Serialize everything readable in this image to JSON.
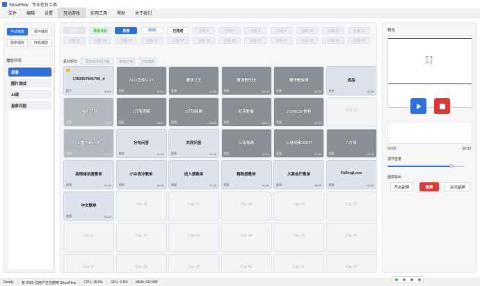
{
  "app": {
    "title": "ShowFlow · 专业控台工具"
  },
  "menu": [
    "文件",
    "编辑",
    "设置",
    "互动游戏",
    "实用工具",
    "帮助",
    "关于我们"
  ],
  "menu_active_index": 3,
  "left": {
    "modes": [
      "手动播放",
      "循环播放",
      "顺序播放",
      "随机播放"
    ],
    "modes_active_index": 0,
    "playlist_label": "播放列表",
    "playlists": [
      "昊香",
      "图片测试",
      "AI课",
      "皇家花园"
    ],
    "playlist_active_index": 0
  },
  "tabs": {
    "row1": [
      {
        "label": "测试",
        "style": "gray"
      },
      {
        "label": "模板体验",
        "style": "green"
      },
      {
        "label": "昊香",
        "style": "blue"
      },
      {
        "label": "2025",
        "style": "bluetxt"
      },
      {
        "label": "已完成",
        "style": "dark"
      },
      {
        "label": "分组 6"
      },
      {
        "label": "分组 7"
      },
      {
        "label": "分组 8"
      },
      {
        "label": "分组 9"
      },
      {
        "label": "分组 10"
      },
      {
        "label": "分组 11"
      },
      {
        "label": "分组 12"
      }
    ],
    "row2": [
      {
        "label": "分组 13"
      },
      {
        "label": "分组 14"
      },
      {
        "label": "分组 15"
      },
      {
        "label": "分组 16"
      },
      {
        "label": "分组 17"
      },
      {
        "label": "分组 18"
      },
      {
        "label": "分组 19"
      },
      {
        "label": "分组 20"
      },
      {
        "label": "分组 21"
      },
      {
        "label": "分组 22"
      },
      {
        "label": "分组 23"
      },
      {
        "label": "分组 24"
      }
    ]
  },
  "tools": {
    "label": "素材矩阵",
    "buttons": [
      "添加载当前页面",
      "移动分类",
      "分轨播放"
    ]
  },
  "cells": [
    {
      "title": "1783957846790_d",
      "kind": "filled",
      "type": "图片",
      "dur": "00:05",
      "badge": true
    },
    {
      "title": "2026宣传片V2",
      "kind": "thumb",
      "type": "视频",
      "dur": "01:04"
    },
    {
      "title": "暖场文艺",
      "kind": "thumb",
      "type": "视频",
      "dur": "01:39"
    },
    {
      "title": "暖场歌欢快",
      "kind": "thumb",
      "type": "视频",
      "dur": "02:16"
    },
    {
      "title": "暖场歌旋律",
      "kind": "thumb",
      "type": "视频",
      "dur": "02:23"
    },
    {
      "title": "成品",
      "kind": "filled",
      "type": "视频",
      "dur": "00:38"
    },
    {
      "title": "1唱礼开场",
      "kind": "thumb",
      "type": "视频",
      "dur": "01:46"
    },
    {
      "title": "2开场视频",
      "kind": "thumb",
      "type": "视频",
      "dur": "06:23"
    },
    {
      "title": "3开场视频",
      "kind": "thumb",
      "type": "视频",
      "dur": "03:03"
    },
    {
      "title": "纪实影像",
      "kind": "thumb",
      "type": "视频",
      "dur": "00:31"
    },
    {
      "title": "20240130快剪",
      "kind": "thumb",
      "type": "视频",
      "dur": "07:44"
    },
    {
      "title": "Clip 12",
      "kind": "empty"
    },
    {
      "title": "5.重大奇入场",
      "kind": "thumb",
      "type": "视频",
      "dur": "01:44"
    },
    {
      "title": "分句问答",
      "kind": "filled",
      "type": "视频",
      "dur": "01:12"
    },
    {
      "title": "共同问答",
      "kind": "filled",
      "type": "视频",
      "dur": "01:35"
    },
    {
      "title": "父母视频",
      "kind": "thumb",
      "type": "视频",
      "dur": "01:49"
    },
    {
      "title": "父母视频1080P",
      "kind": "thumb",
      "type": "视频",
      "dur": "02:48"
    },
    {
      "title": "7.片尾",
      "kind": "thumb",
      "type": "视频",
      "dur": "02:19"
    },
    {
      "title": "高情绪浓度歌单",
      "kind": "filled",
      "type": "视频",
      "dur": "01:49"
    },
    {
      "title": "小众清冷歌单",
      "kind": "filled",
      "type": "视频",
      "dur": "00:23"
    },
    {
      "title": "送人感歌单",
      "kind": "filled",
      "type": "视频",
      "dur": "01:33"
    },
    {
      "title": "精致感歌单",
      "kind": "filled",
      "type": "视频",
      "dur": "01:45"
    },
    {
      "title": "大宴会厅歌单",
      "kind": "filled",
      "type": "视频",
      "dur": "02:09"
    },
    {
      "title": "FallingLove",
      "kind": "filled",
      "type": "视频",
      "dur": "02:04"
    },
    {
      "title": "中文歌单",
      "kind": "filled",
      "type": "视频",
      "dur": "01:20"
    },
    {
      "title": "Clip 26",
      "kind": "empty"
    },
    {
      "title": "Clip 27",
      "kind": "empty"
    },
    {
      "title": "Clip 28",
      "kind": "empty"
    },
    {
      "title": "Clip 29",
      "kind": "empty"
    },
    {
      "title": "Clip 30",
      "kind": "empty"
    },
    {
      "title": "Clip 31",
      "kind": "empty"
    },
    {
      "title": "Clip 32",
      "kind": "empty"
    },
    {
      "title": "Clip 33",
      "kind": "empty"
    },
    {
      "title": "Clip 34",
      "kind": "empty"
    },
    {
      "title": "Clip 35",
      "kind": "empty"
    },
    {
      "title": "Clip 36",
      "kind": "empty"
    },
    {
      "title": "Clip 37",
      "kind": "empty"
    },
    {
      "title": "Clip 38",
      "kind": "empty"
    },
    {
      "title": "Clip 39",
      "kind": "empty"
    },
    {
      "title": "Clip 40",
      "kind": "empty"
    },
    {
      "title": "Clip 41",
      "kind": "empty"
    },
    {
      "title": "Clip 42",
      "kind": "empty"
    }
  ],
  "right": {
    "preview_label": "预览",
    "time_current": "00:00",
    "time_total": "00:00",
    "volume_label": "调节音量",
    "volume_level": 0.82,
    "subtitle_label": "副屏输出",
    "subtitle_buttons": [
      "开启副屏",
      "黑屏",
      "关闭副屏"
    ]
  },
  "status": {
    "ready": "Ready",
    "users": "有 2669 位用户正在使用 ShowFlow",
    "cpu": "CPU: 18.0%",
    "gpu": "GPU: 0.5%",
    "mem": "MEM: 610 MB"
  },
  "colors": {
    "accent": "#2f6fd8",
    "danger": "#d83a36",
    "green": "#3fd13f"
  }
}
